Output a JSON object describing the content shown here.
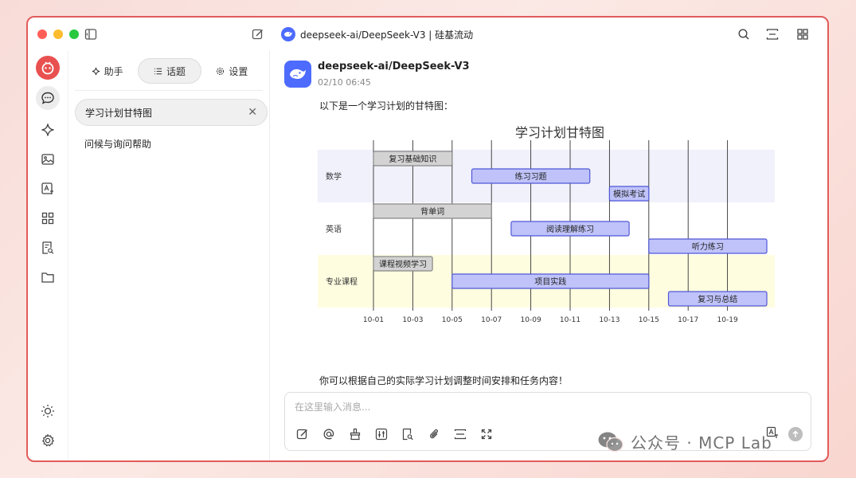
{
  "window": {
    "title": "deepseek-ai/DeepSeek-V3 | 硅基流动"
  },
  "panel": {
    "tabs": [
      {
        "label": "助手"
      },
      {
        "label": "话题"
      },
      {
        "label": "设置"
      }
    ],
    "active_tab": "话题",
    "topics": [
      {
        "label": "学习计划甘特图",
        "active": true
      },
      {
        "label": "问候与询问帮助",
        "active": false
      }
    ]
  },
  "message": {
    "model_name": "deepseek-ai/DeepSeek-V3",
    "time": "02/10 06:45",
    "intro": "以下是一个学习计划的甘特图：",
    "outro": "你可以根据自己的实际学习计划调整时间安排和任务内容！"
  },
  "chart_data": {
    "type": "gantt",
    "title": "学习计划甘特图",
    "x_ticks": [
      "10-01",
      "10-03",
      "10-05",
      "10-07",
      "10-09",
      "10-11",
      "10-13",
      "10-15",
      "10-17",
      "10-19"
    ],
    "x_range": [
      "10-01",
      "10-21"
    ],
    "sections": [
      {
        "name": "数学",
        "color": "#f0f1fb",
        "tasks": [
          {
            "label": "复习基础知识",
            "start": "10-01",
            "end": "10-05",
            "style": "done"
          },
          {
            "label": "练习习题",
            "start": "10-06",
            "end": "10-12",
            "style": "active"
          },
          {
            "label": "模拟考试",
            "start": "10-13",
            "end": "10-15",
            "style": "active"
          }
        ]
      },
      {
        "name": "英语",
        "color": "#ffffff",
        "tasks": [
          {
            "label": "背单词",
            "start": "10-01",
            "end": "10-07",
            "style": "done"
          },
          {
            "label": "阅读理解练习",
            "start": "10-08",
            "end": "10-14",
            "style": "active"
          },
          {
            "label": "听力练习",
            "start": "10-15",
            "end": "10-21",
            "style": "active"
          }
        ]
      },
      {
        "name": "专业课程",
        "color": "#fefde0",
        "tasks": [
          {
            "label": "课程视频学习",
            "start": "10-01",
            "end": "10-04",
            "style": "done"
          },
          {
            "label": "项目实践",
            "start": "10-05",
            "end": "10-15",
            "style": "active"
          },
          {
            "label": "复习与总结",
            "start": "10-16",
            "end": "10-21",
            "style": "active"
          }
        ]
      }
    ],
    "colors": {
      "done_fill": "#d3d3d3",
      "done_stroke": "#888888",
      "active_fill": "#bfc3f9",
      "active_stroke": "#5157d8"
    }
  },
  "input": {
    "placeholder": "在这里输入消息..."
  },
  "watermark": {
    "text": "公众号 · MCP Lab"
  },
  "colors": {
    "accent": "#e25b5b",
    "brand": "#e8514f",
    "deepseek": "#4d6bfe"
  }
}
